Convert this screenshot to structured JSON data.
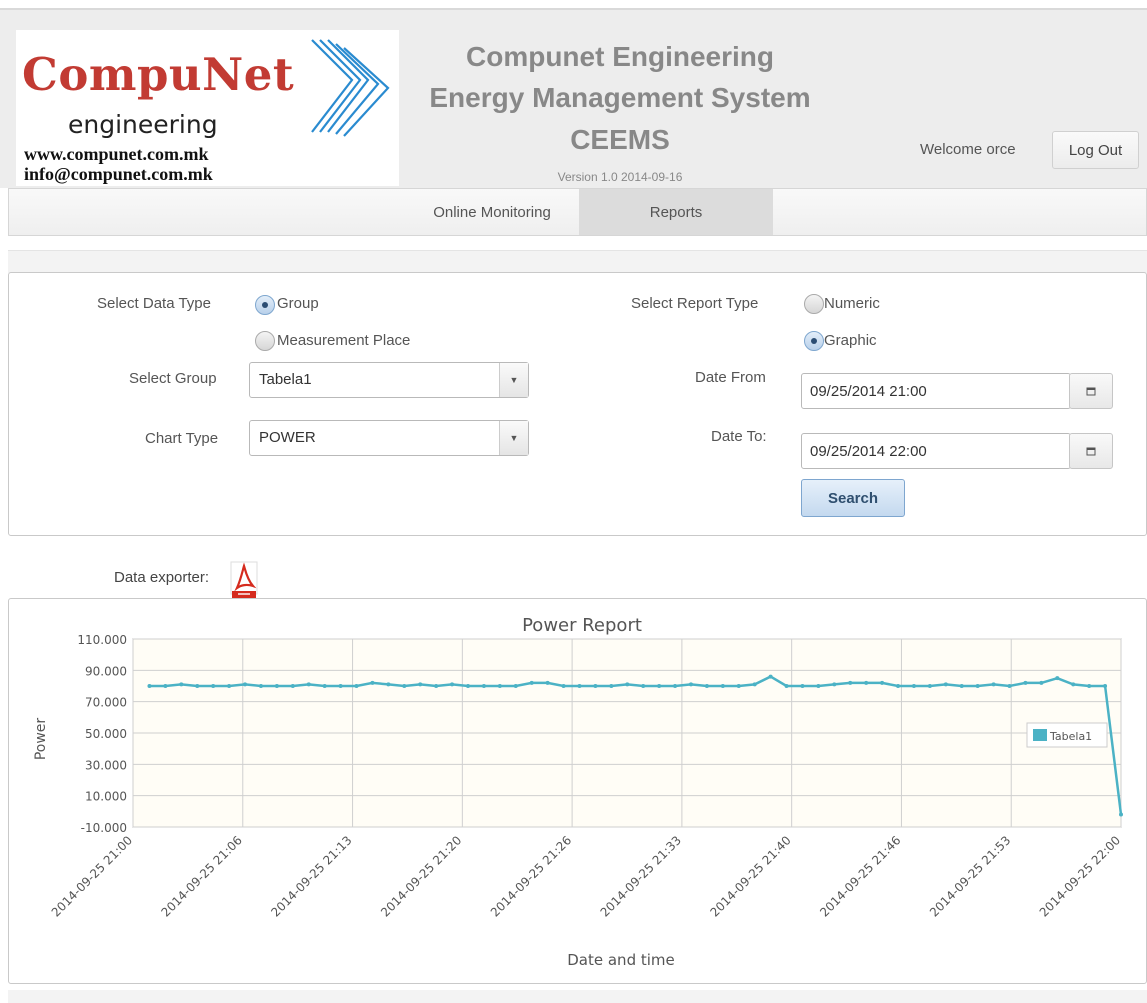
{
  "header": {
    "logo": {
      "title": "CompuNet",
      "subtitle": "engineering",
      "website": "www.compunet.com.mk",
      "email": "info@compunet.com.mk"
    },
    "app_title_line1": "Compunet Engineering",
    "app_title_line2": "Energy Management System",
    "app_title_line3": "CEEMS",
    "version": "Version 1.0 2014-09-16",
    "welcome": "Welcome orce",
    "logout_label": "Log Out"
  },
  "menu": {
    "tabs": [
      {
        "label": "Online Monitoring",
        "active": false
      },
      {
        "label": "Reports",
        "active": true
      }
    ]
  },
  "form": {
    "data_type_label": "Select Data Type",
    "data_type_options": [
      {
        "label": "Group",
        "selected": true
      },
      {
        "label": "Measurement Place",
        "selected": false
      }
    ],
    "group_label": "Select Group",
    "group_value": "Tabela1",
    "chart_type_label": "Chart Type",
    "chart_type_value": "POWER",
    "report_type_label": "Select Report Type",
    "report_type_options": [
      {
        "label": "Numeric",
        "selected": false
      },
      {
        "label": "Graphic",
        "selected": true
      }
    ],
    "date_from_label": "Date From",
    "date_from_value": "09/25/2014 21:00",
    "date_to_label": "Date To:",
    "date_to_value": "09/25/2014 22:00",
    "search_label": "Search"
  },
  "exporter": {
    "label": "Data exporter:",
    "icon": "pdf-icon"
  },
  "colors": {
    "series": "#4bb2c5",
    "plot_bg": "#fffdf6",
    "logo_red": "#c23b33",
    "logo_blue": "#2a8bd0"
  },
  "chart_data": {
    "type": "line",
    "title": "Power Report",
    "xlabel": "Date and time",
    "ylabel": "Power",
    "ylim": [
      -10,
      110
    ],
    "yticks": [
      "110.000",
      "90.000",
      "70.000",
      "50.000",
      "30.000",
      "10.000",
      "-10.000"
    ],
    "xlim_minutes": [
      0,
      60
    ],
    "xticks": [
      "2014-09-25 21:00",
      "2014-09-25 21:06",
      "2014-09-25 21:13",
      "2014-09-25 21:20",
      "2014-09-25 21:26",
      "2014-09-25 21:33",
      "2014-09-25 21:40",
      "2014-09-25 21:46",
      "2014-09-25 21:53",
      "2014-09-25 22:00"
    ],
    "grid": true,
    "legend": {
      "position": "right",
      "entries": [
        "Tabela1"
      ]
    },
    "series": [
      {
        "name": "Tabela1",
        "x_minutes": [
          1,
          2,
          3,
          4,
          5,
          6,
          7,
          8,
          9,
          10,
          11,
          12,
          13,
          14,
          15,
          16,
          17,
          18,
          19,
          20,
          21,
          22,
          23,
          24,
          25,
          26,
          27,
          28,
          29,
          30,
          31,
          32,
          33,
          34,
          35,
          36,
          37,
          38,
          39,
          40,
          41,
          42,
          43,
          44,
          45,
          46,
          47,
          48,
          49,
          50,
          51,
          52,
          53,
          54,
          55,
          56,
          57,
          58,
          59,
          60
        ],
        "values": [
          80,
          80,
          81,
          80,
          80,
          80,
          81,
          80,
          80,
          80,
          81,
          80,
          80,
          80,
          82,
          81,
          80,
          81,
          80,
          81,
          80,
          80,
          80,
          80,
          82,
          82,
          80,
          80,
          80,
          80,
          81,
          80,
          80,
          80,
          81,
          80,
          80,
          80,
          81,
          86,
          80,
          80,
          80,
          81,
          82,
          82,
          82,
          80,
          80,
          80,
          81,
          80,
          80,
          81,
          80,
          82,
          82,
          85,
          81,
          80,
          80,
          -2
        ]
      }
    ]
  }
}
